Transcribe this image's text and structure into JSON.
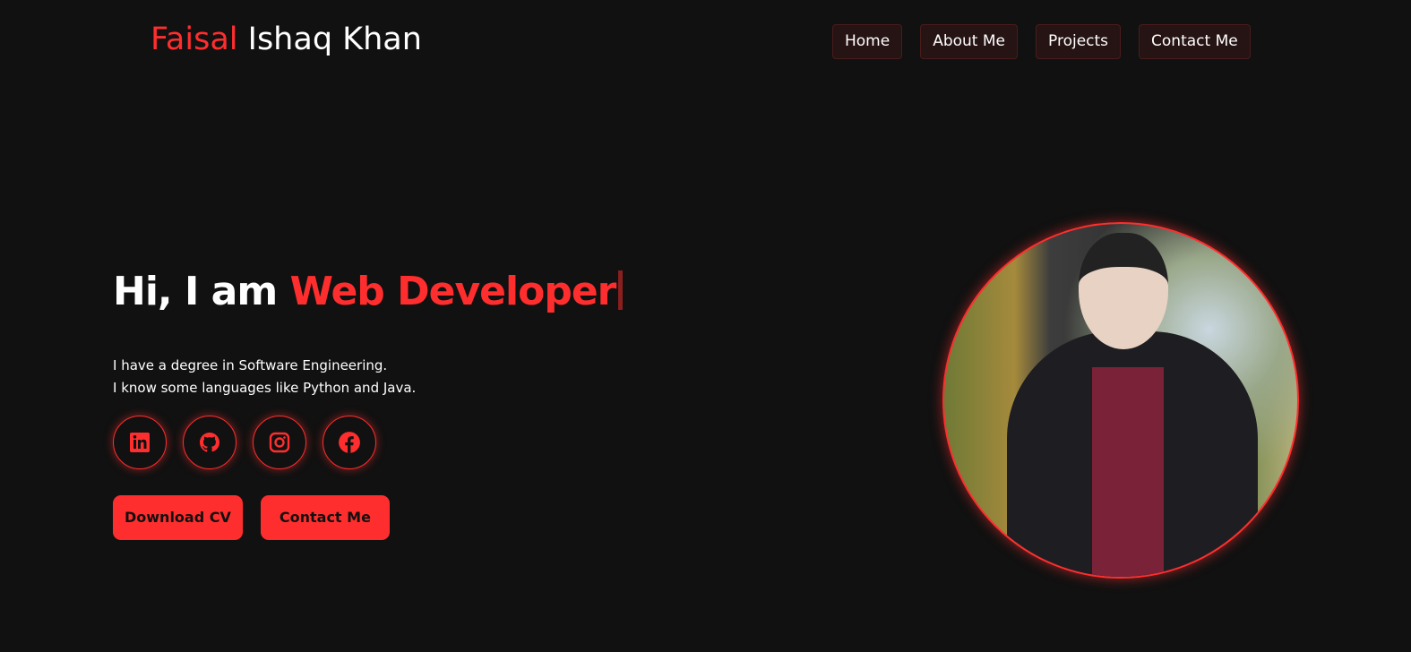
{
  "header": {
    "logo_first": "Faisal",
    "logo_rest": " Ishaq Khan",
    "nav": [
      {
        "label": "Home"
      },
      {
        "label": "About Me"
      },
      {
        "label": "Projects"
      },
      {
        "label": "Contact Me"
      }
    ]
  },
  "hero": {
    "greeting": "Hi, I am ",
    "role": "Web Developer",
    "desc_line1": "I have a degree in Software Engineering.",
    "desc_line2": "I know some languages like Python and Java.",
    "social": [
      {
        "icon": "linkedin-icon"
      },
      {
        "icon": "github-icon"
      },
      {
        "icon": "instagram-icon"
      },
      {
        "icon": "facebook-icon"
      }
    ],
    "download_label": "Download CV",
    "contact_label": "Contact Me"
  },
  "colors": {
    "accent": "#ff2e2e",
    "background": "#111111",
    "nav_bg": "#261313"
  }
}
